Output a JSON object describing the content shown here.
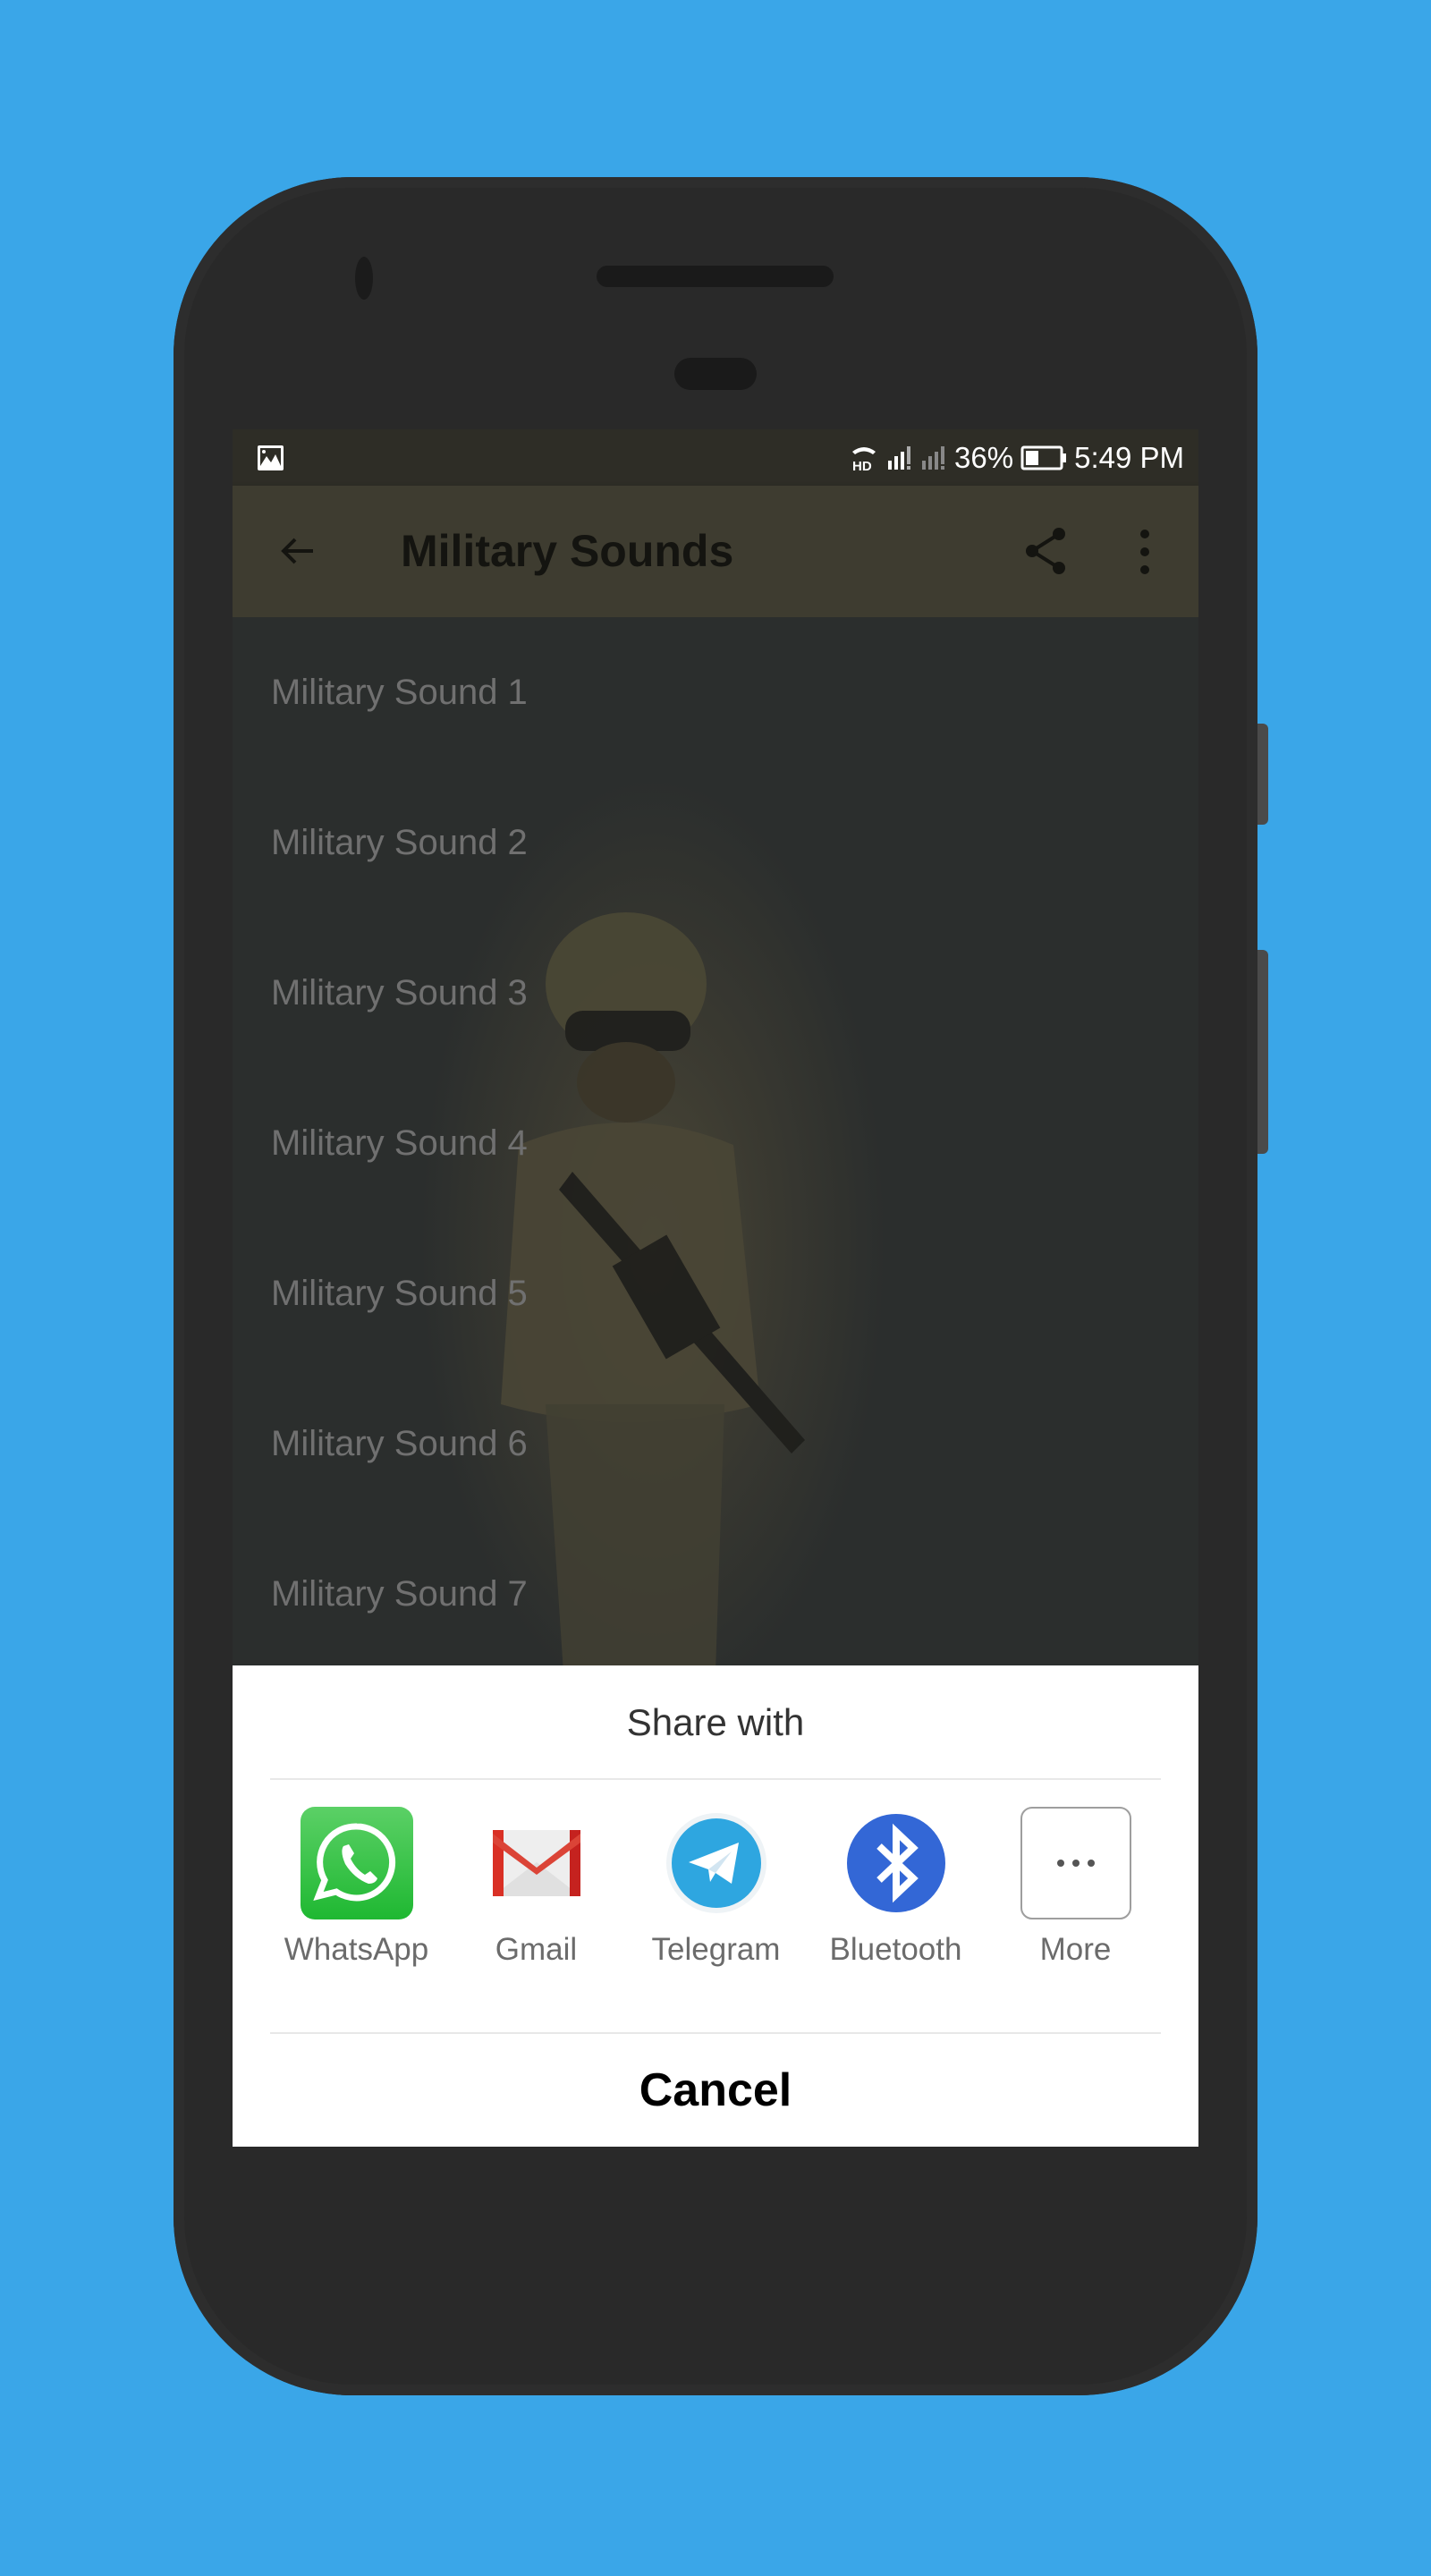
{
  "background_color": "#3aa6e8",
  "status_bar": {
    "left_icon": "image-notification-icon",
    "icons": [
      "hd-call-icon",
      "signal-sim1-icon",
      "signal-sim2-icon"
    ],
    "battery_percent": "36%",
    "battery_icon": "battery-icon",
    "time": "5:49 PM"
  },
  "app_bar": {
    "back_icon": "arrow-back-icon",
    "title": "Military Sounds",
    "share_icon": "share-icon",
    "more_icon": "more-vert-icon",
    "color": "#3e3c30"
  },
  "list": {
    "items": [
      {
        "label": "Military Sound 1"
      },
      {
        "label": "Military Sound 2"
      },
      {
        "label": "Military Sound 3"
      },
      {
        "label": "Military Sound 4"
      },
      {
        "label": "Military Sound 5"
      },
      {
        "label": "Military Sound 6"
      },
      {
        "label": "Military Sound 7"
      }
    ]
  },
  "share_sheet": {
    "title": "Share with",
    "apps": [
      {
        "label": "WhatsApp",
        "icon": "whatsapp-icon",
        "color": "#25c23f"
      },
      {
        "label": "Gmail",
        "icon": "gmail-icon",
        "color": "#d93025"
      },
      {
        "label": "Telegram",
        "icon": "telegram-icon",
        "color": "#2ea6e0"
      },
      {
        "label": "Bluetooth",
        "icon": "bluetooth-icon",
        "color": "#3367d6"
      },
      {
        "label": "More",
        "icon": "more-horiz-icon",
        "color": "#555555"
      }
    ],
    "cancel_label": "Cancel"
  }
}
